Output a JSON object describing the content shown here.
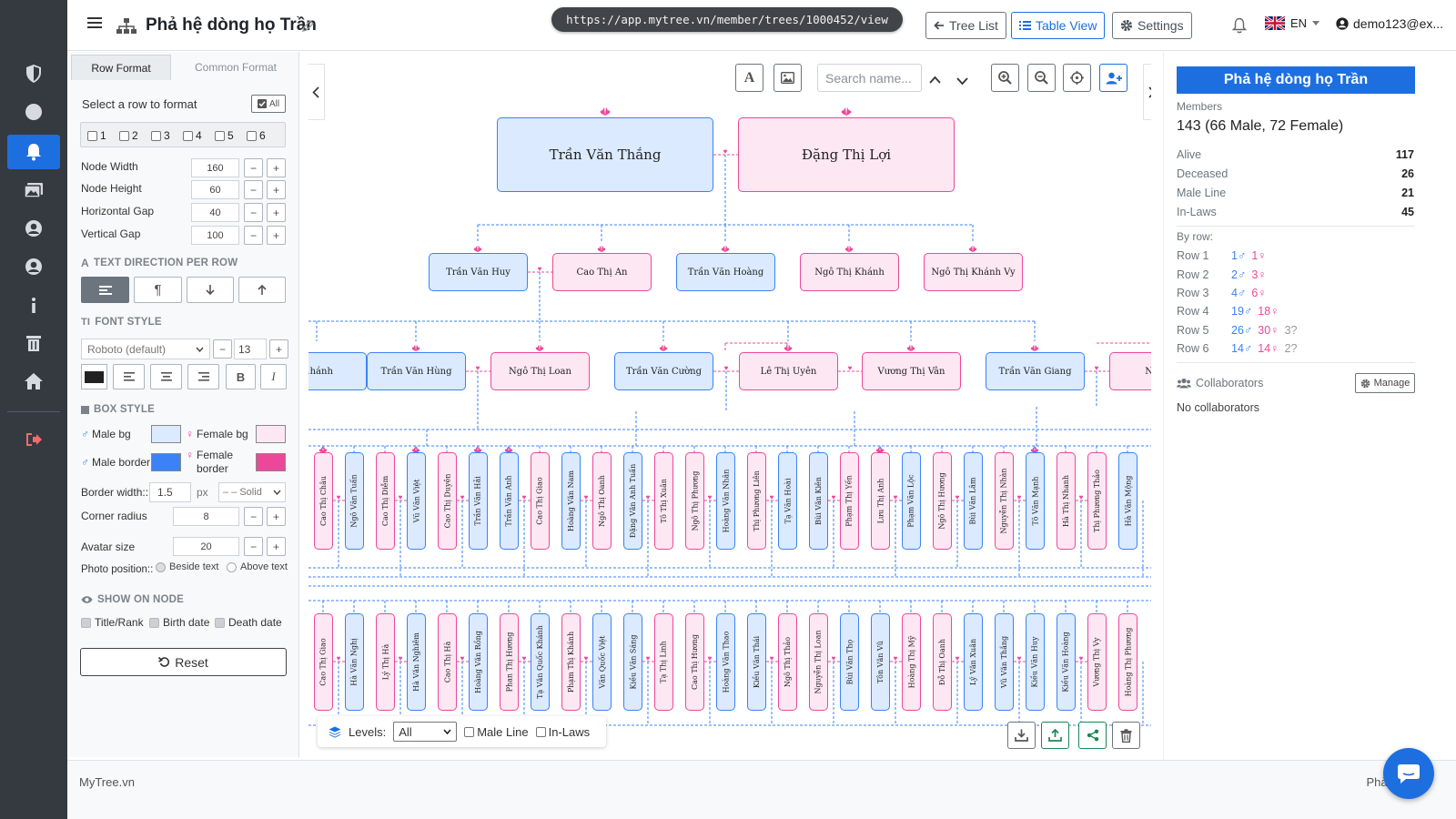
{
  "app": {
    "title": "Phả hệ dòng họ Trần",
    "url": "https://app.mytree.vn/member/trees/1000452/view",
    "footer_brand": "MyTree.vn",
    "footer_right": "Phả hệ số",
    "accent": "#1d6fe0",
    "male_color": "#3b82f6",
    "female_color": "#ec4899"
  },
  "toolbar": {
    "tree_list": "Tree List",
    "table_view": "Table View",
    "settings": "Settings",
    "lang": "EN",
    "user": "demo123@ex..."
  },
  "sidebar_icons": [
    "shield-icon",
    "circle-icon",
    "bell-icon",
    "image-icon",
    "user-circle-icon",
    "user-circle-icon",
    "info-icon",
    "trash-icon",
    "home-icon",
    "sign-out-icon"
  ],
  "format_panel": {
    "tabs": [
      "Row Format",
      "Common Format"
    ],
    "select_row": "Select a row to format",
    "all_btn": "All",
    "rows": [
      "1",
      "2",
      "3",
      "4",
      "5",
      "6"
    ],
    "fields": [
      {
        "label": "Node Width",
        "value": "160"
      },
      {
        "label": "Node Height",
        "value": "60"
      },
      {
        "label": "Horizontal Gap",
        "value": "40"
      },
      {
        "label": "Vertical Gap",
        "value": "100"
      }
    ],
    "text_direction_title": "TEXT DIRECTION PER ROW",
    "font_style_title": "FONT STYLE",
    "font_family": "Roboto (default)",
    "font_size": "13",
    "box_style_title": "BOX STYLE",
    "male_bg": "Male bg",
    "female_bg": "Female bg",
    "male_border": "Male border",
    "female_border": "Female border",
    "male_bg_color": "#dbeafe",
    "female_bg_color": "#fce7f3",
    "male_border_color": "#3b82f6",
    "female_border_color": "#ec4899",
    "text_color": "#222222",
    "border_width_label": "Border width::",
    "border_width": "1.5",
    "border_unit": "px",
    "border_style": "– – Solid",
    "corner_radius_label": "Corner radius",
    "corner_radius": "8",
    "avatar_size_label": "Avatar size",
    "avatar_size": "20",
    "photo_position_label": "Photo position::",
    "photo_beside": "Beside text",
    "photo_above": "Above text",
    "show_on_node_title": "SHOW ON NODE",
    "show_title": "Title/Rank",
    "show_birth": "Birth date",
    "show_death": "Death date",
    "reset": "Reset"
  },
  "chart_controls": {
    "search_placeholder": "Search name...",
    "levels_label": "Levels:",
    "levels_value": "All",
    "male_line": "Male Line",
    "in_laws": "In-Laws"
  },
  "tree": {
    "row1": [
      {
        "name": "Trần Văn Thắng",
        "g": "m"
      },
      {
        "name": "Đặng Thị Lợi",
        "g": "f"
      }
    ],
    "row2": [
      {
        "name": "Trần Văn Huy",
        "g": "m"
      },
      {
        "name": "Cao Thị An",
        "g": "f"
      },
      {
        "name": "Trần Văn Hoàng",
        "g": "m"
      },
      {
        "name": "Ngô Thị Khánh",
        "g": "f"
      },
      {
        "name": "Ngô Thị Khánh Vy",
        "g": "f"
      }
    ],
    "row3": [
      {
        "name": "...hánh",
        "g": "m"
      },
      {
        "name": "Trần Văn Hùng",
        "g": "m"
      },
      {
        "name": "Ngô Thị Loan",
        "g": "f"
      },
      {
        "name": "Trần Văn Cường",
        "g": "m"
      },
      {
        "name": "Lê Thị Uyên",
        "g": "f"
      },
      {
        "name": "Vương Thị Vân",
        "g": "f"
      },
      {
        "name": "Trần Văn Giang",
        "g": "m"
      },
      {
        "name": "Ngô...",
        "g": "f"
      }
    ],
    "row4": [
      {
        "name": "Cao Thị Châu",
        "g": "f"
      },
      {
        "name": "Ngô Văn Tuấn",
        "g": "m"
      },
      {
        "name": "Cao Thị Diễm",
        "g": "f"
      },
      {
        "name": "Vũ Văn Việt",
        "g": "m"
      },
      {
        "name": "Cao Thị Duyên",
        "g": "f"
      },
      {
        "name": "Trần Văn Hải",
        "g": "m"
      },
      {
        "name": "Trần Văn Anh",
        "g": "m"
      },
      {
        "name": "Cao Thị Giao",
        "g": "f"
      },
      {
        "name": "Hoàng Văn Nam",
        "g": "m"
      },
      {
        "name": "Ngô Thị Oanh",
        "g": "f"
      },
      {
        "name": "Đặng Văn Anh Tuấn",
        "g": "m"
      },
      {
        "name": "Tô Thị Xuân",
        "g": "f"
      },
      {
        "name": "Ngô Thị Phương",
        "g": "f"
      },
      {
        "name": "Hoàng Văn Nhân",
        "g": "m"
      },
      {
        "name": "Thị Phương Liên",
        "g": "f"
      },
      {
        "name": "Tạ Văn Hoài",
        "g": "m"
      },
      {
        "name": "Bùi Văn Kiên",
        "g": "m"
      },
      {
        "name": "Phạm Thị Yến",
        "g": "f"
      },
      {
        "name": "Lưu Thị Anh",
        "g": "f"
      },
      {
        "name": "Phạm Văn Lộc",
        "g": "m"
      },
      {
        "name": "Ngô Thị Hương",
        "g": "f"
      },
      {
        "name": "Bùi Văn Lâm",
        "g": "m"
      },
      {
        "name": "Nguyễn Thị Nhàn",
        "g": "f"
      },
      {
        "name": "Tô Văn Mạnh",
        "g": "m"
      },
      {
        "name": "Hà Thị Nhanh",
        "g": "f"
      },
      {
        "name": "Thị Phương Thảo",
        "g": "f"
      },
      {
        "name": "Hà Văn Mộng",
        "g": "m"
      }
    ],
    "row5": [
      {
        "name": "Cao Thị Giao",
        "g": "f"
      },
      {
        "name": "Hà Văn Nghị",
        "g": "m"
      },
      {
        "name": "Lý Thị Hà",
        "g": "f"
      },
      {
        "name": "Hà Văn Nghiêm",
        "g": "m"
      },
      {
        "name": "Cao Thị Hà",
        "g": "f"
      },
      {
        "name": "Hoàng Văn Rồng",
        "g": "m"
      },
      {
        "name": "Phan Thị Hương",
        "g": "f"
      },
      {
        "name": "Tạ Văn Quốc Khánh",
        "g": "m"
      },
      {
        "name": "Phạm Thị Khánh",
        "g": "f"
      },
      {
        "name": "Văn Quốc Việt",
        "g": "m"
      },
      {
        "name": "Kiều Văn Sáng",
        "g": "m"
      },
      {
        "name": "Tạ Thị Linh",
        "g": "f"
      },
      {
        "name": "Cao Thị Hương",
        "g": "f"
      },
      {
        "name": "Hoàng Văn Thao",
        "g": "m"
      },
      {
        "name": "Kiều Văn Thái",
        "g": "m"
      },
      {
        "name": "Ngô Thị Thảo",
        "g": "f"
      },
      {
        "name": "Nguyễn Thị Loan",
        "g": "f"
      },
      {
        "name": "Bùi Văn Thọ",
        "g": "m"
      },
      {
        "name": "Tôn Văn Vũ",
        "g": "m"
      },
      {
        "name": "Hoàng Thị Mỹ",
        "g": "f"
      },
      {
        "name": "Đỗ Thị Oanh",
        "g": "f"
      },
      {
        "name": "Lý Văn Xuân",
        "g": "m"
      },
      {
        "name": "Vũ Văn Thắng",
        "g": "m"
      },
      {
        "name": "Kiều Văn Huy",
        "g": "m"
      },
      {
        "name": "Kiều Văn Hoàng",
        "g": "m"
      },
      {
        "name": "Vương Thị Vy",
        "g": "f"
      },
      {
        "name": "Hoàng Thị Phương",
        "g": "f"
      }
    ]
  },
  "stats": {
    "title": "Phả hệ dòng họ Trần",
    "members_label": "Members",
    "members_summary": "143 (66 Male, 72 Female)",
    "kv": [
      {
        "label": "Alive",
        "value": "117"
      },
      {
        "label": "Deceased",
        "value": "26"
      },
      {
        "label": "Male Line",
        "value": "21"
      },
      {
        "label": "In-Laws",
        "value": "45"
      }
    ],
    "by_row_label": "By row:",
    "rows": [
      {
        "label": "Row 1",
        "male": "1♂",
        "female": "1♀",
        "unknown": ""
      },
      {
        "label": "Row 2",
        "male": "2♂",
        "female": "3♀",
        "unknown": ""
      },
      {
        "label": "Row 3",
        "male": "4♂",
        "female": "6♀",
        "unknown": ""
      },
      {
        "label": "Row 4",
        "male": "19♂",
        "female": "18♀",
        "unknown": ""
      },
      {
        "label": "Row 5",
        "male": "26♂",
        "female": "30♀",
        "unknown": "3?"
      },
      {
        "label": "Row 6",
        "male": "14♂",
        "female": "14♀",
        "unknown": "2?"
      }
    ],
    "collaborators_label": "Collaborators",
    "manage": "Manage",
    "no_collaborators": "No collaborators"
  }
}
